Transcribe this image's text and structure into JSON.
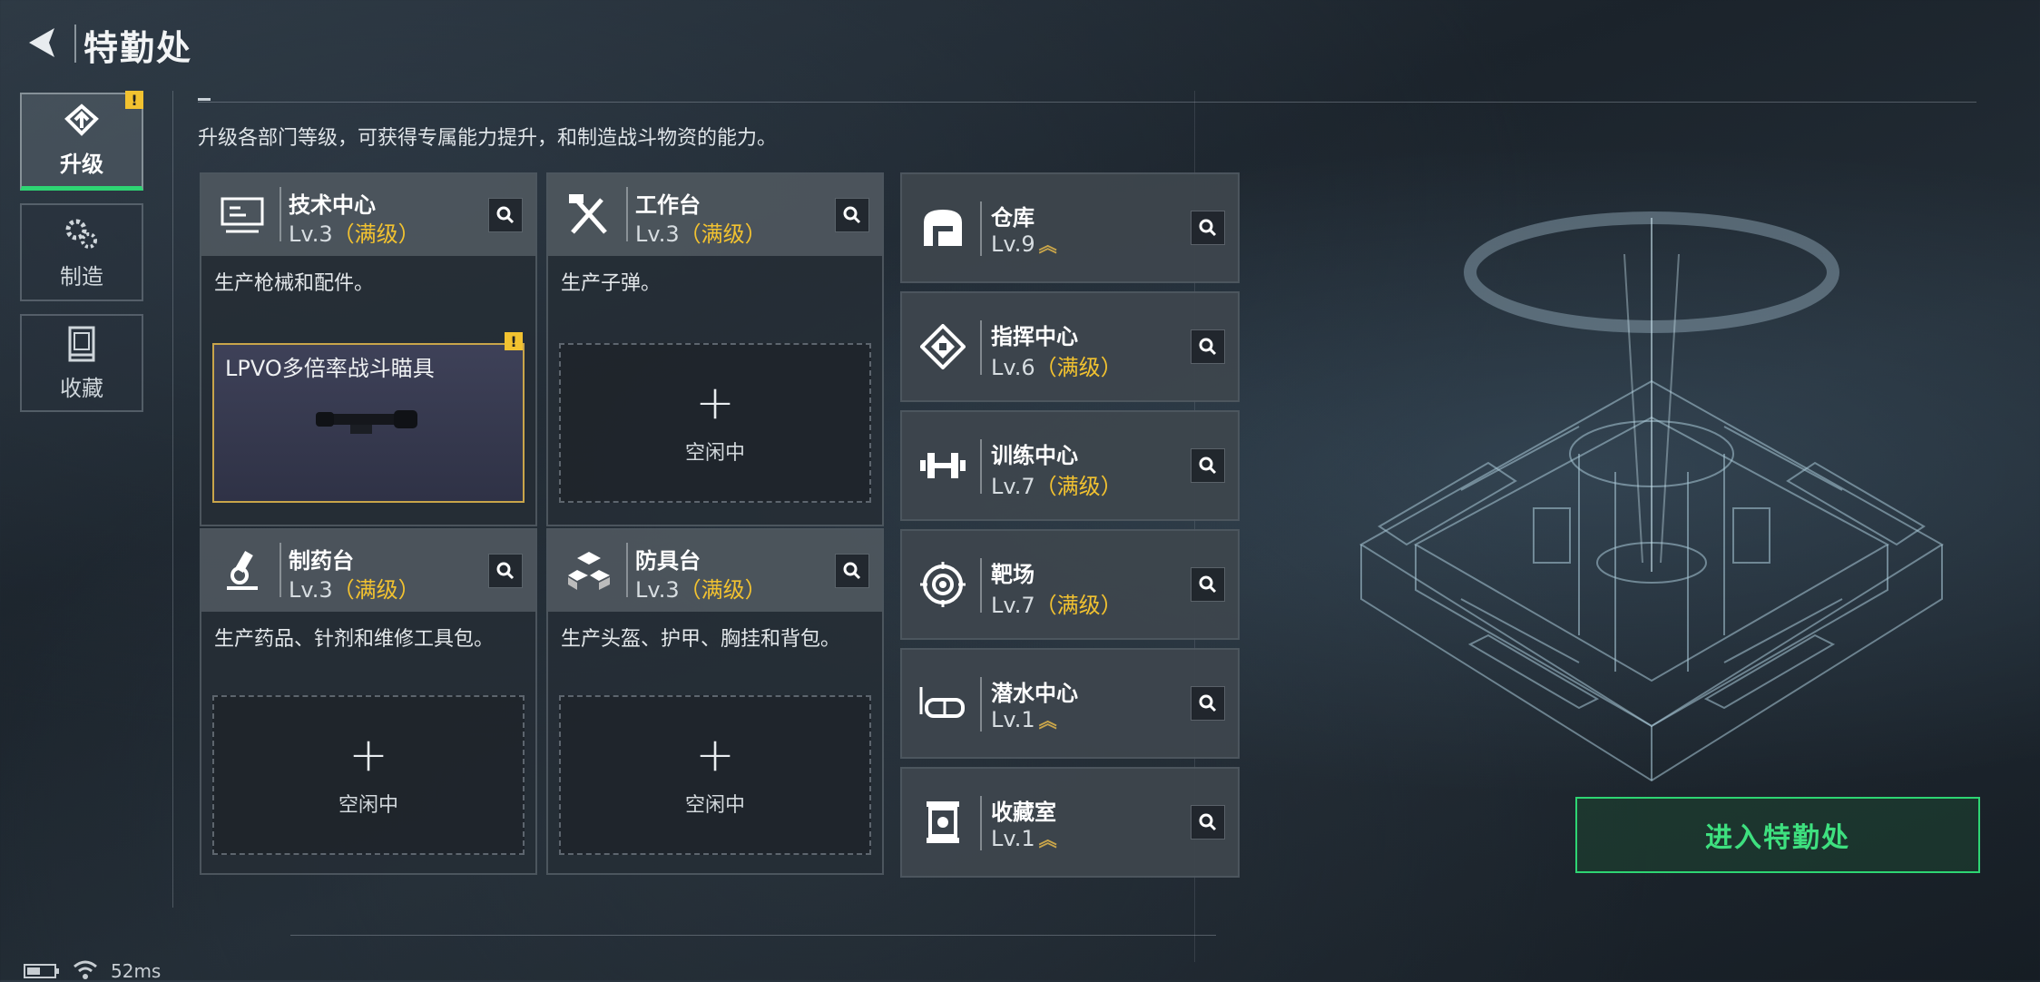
{
  "header": {
    "title": "特勤处"
  },
  "nav": [
    {
      "label": "升级",
      "icon": "upgrade-icon",
      "active": true,
      "alert": "!"
    },
    {
      "label": "制造",
      "icon": "gears-icon",
      "active": false
    },
    {
      "label": "收藏",
      "icon": "collection-icon",
      "active": false
    }
  ],
  "description": "升级各部门等级，可获得专属能力提升，和制造战斗物资的能力。",
  "workshops": [
    {
      "name": "技术中心",
      "level": "Lv.3",
      "level_note": "（满级）",
      "icon": "computer-icon",
      "desc": "生产枪械和配件。",
      "slot_item": "LPVO多倍率战斗瞄具",
      "slot_alert": "!"
    },
    {
      "name": "工作台",
      "level": "Lv.3",
      "level_note": "（满级）",
      "icon": "tools-icon",
      "desc": "生产子弹。",
      "slot_plus": "+",
      "slot_status": "空闲中"
    },
    {
      "name": "制药台",
      "level": "Lv.3",
      "level_note": "（满级）",
      "icon": "microscope-icon",
      "desc": "生产药品、针剂和维修工具包。",
      "slot_plus": "+",
      "slot_status": "空闲中"
    },
    {
      "name": "防具台",
      "level": "Lv.3",
      "level_note": "（满级）",
      "icon": "armor-blocks-icon",
      "desc": "生产头盔、护甲、胸挂和背包。",
      "slot_plus": "+",
      "slot_status": "空闲中"
    }
  ],
  "facilities": [
    {
      "name": "仓库",
      "level": "Lv.9",
      "level_note": "",
      "upgradable": true,
      "icon": "warehouse-icon"
    },
    {
      "name": "指挥中心",
      "level": "Lv.6",
      "level_note": "（满级）",
      "upgradable": false,
      "icon": "command-icon"
    },
    {
      "name": "训练中心",
      "level": "Lv.7",
      "level_note": "（满级）",
      "upgradable": false,
      "icon": "dumbbell-icon"
    },
    {
      "name": "靶场",
      "level": "Lv.7",
      "level_note": "（满级）",
      "upgradable": false,
      "icon": "target-icon"
    },
    {
      "name": "潜水中心",
      "level": "Lv.1",
      "level_note": "",
      "upgradable": true,
      "icon": "diving-mask-icon"
    },
    {
      "name": "收藏室",
      "level": "Lv.1",
      "level_note": "",
      "upgradable": true,
      "icon": "vault-icon"
    }
  ],
  "enter_button": "进入特勤处",
  "status": {
    "ping": "52ms"
  },
  "colors": {
    "accent_green": "#2ed573",
    "max_level_yellow": "#f2c230",
    "alert_yellow": "#f2c230"
  }
}
